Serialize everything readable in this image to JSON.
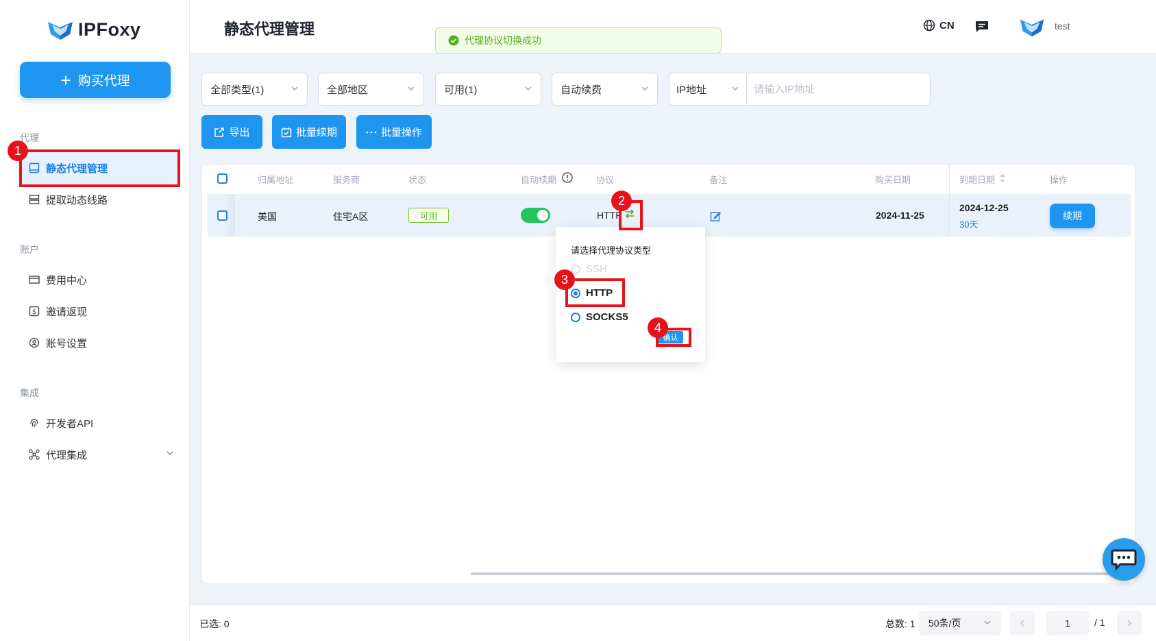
{
  "brand": {
    "name": "IPFoxy"
  },
  "sidebar": {
    "buy_label": "购买代理",
    "sections": [
      {
        "label": "代理",
        "items": [
          {
            "label": "静态代理管理"
          },
          {
            "label": "提取动态线路"
          }
        ]
      },
      {
        "label": "账户",
        "items": [
          {
            "label": "费用中心"
          },
          {
            "label": "邀请返现"
          },
          {
            "label": "账号设置"
          }
        ]
      },
      {
        "label": "集成",
        "items": [
          {
            "label": "开发者API"
          },
          {
            "label": "代理集成"
          }
        ]
      }
    ]
  },
  "header": {
    "title": "静态代理管理",
    "toast": "代理协议切换成功",
    "lang": "CN",
    "username": "test"
  },
  "filters": {
    "type": "全部类型(1)",
    "region": "全部地区",
    "availability": "可用(1)",
    "renew": "自动续费",
    "ip_type": "IP地址",
    "ip_placeholder": "请输入IP地址"
  },
  "actions": {
    "export": "导出",
    "batch_renew": "批量续期",
    "batch_ops": "批量操作"
  },
  "table": {
    "headers": [
      "归属地址",
      "服务商",
      "状态",
      "自动续期",
      "协议",
      "备注",
      "购买日期",
      "到期日期",
      "操作"
    ],
    "rows": [
      {
        "location": "美国",
        "provider": "住宅A区",
        "status": "可用",
        "protocol": "HTTP",
        "purchase_date": "2024-11-25",
        "expire_date": "2024-12-25",
        "remaining": "30天",
        "action": "续期",
        "auto_renew": true
      }
    ]
  },
  "popup": {
    "title": "请选择代理协议类型",
    "options": [
      "SSH",
      "HTTP",
      "SOCKS5"
    ],
    "selected": "HTTP",
    "confirm": "确认"
  },
  "annotations": [
    "1",
    "2",
    "3",
    "4"
  ],
  "footer": {
    "selected": "已选: 0",
    "total": "总数: 1",
    "page_size": "50条/页",
    "page": "1",
    "page_total": "/ 1"
  },
  "colors": {
    "primary": "#1e96f0",
    "annotation": "#e8121b",
    "success": "#52b019"
  }
}
